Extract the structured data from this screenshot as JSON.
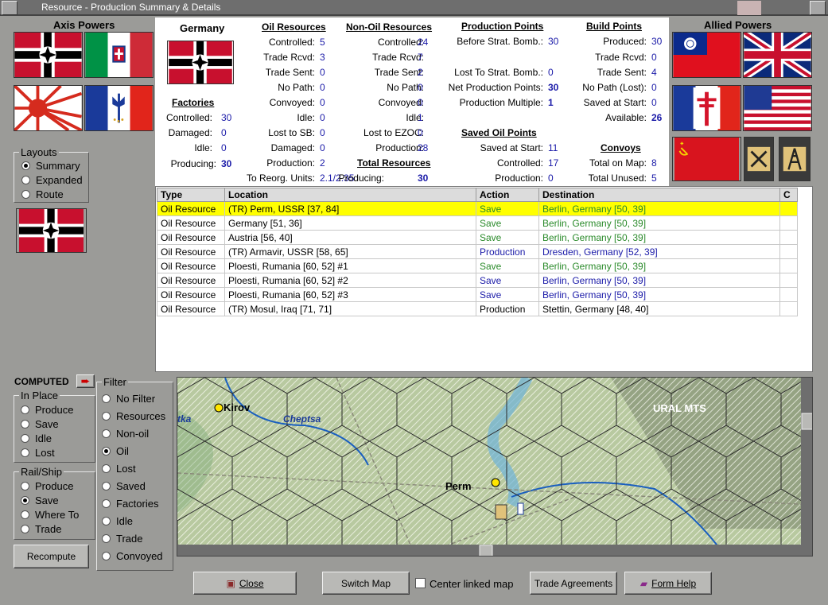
{
  "window": {
    "title": "Resource - Production Summary & Details"
  },
  "axis": {
    "title": "Axis Powers"
  },
  "allied": {
    "title": "Allied Powers"
  },
  "germany": {
    "name": "Germany"
  },
  "factories": {
    "title": "Factories",
    "rows": [
      {
        "label": "Controlled:",
        "value": "30"
      },
      {
        "label": "Damaged:",
        "value": "0"
      },
      {
        "label": "Idle:",
        "value": "0"
      },
      {
        "label": "Producing:",
        "value": "30"
      }
    ]
  },
  "oil": {
    "title": "Oil Resources",
    "rows": [
      {
        "label": "Controlled:",
        "value": "5"
      },
      {
        "label": "Trade Rcvd:",
        "value": "3"
      },
      {
        "label": "Trade Sent:",
        "value": "0"
      },
      {
        "label": "No Path:",
        "value": "0"
      },
      {
        "label": "Convoyed:",
        "value": "0"
      },
      {
        "label": "Idle:",
        "value": "0"
      },
      {
        "label": "Lost to SB:",
        "value": "0"
      },
      {
        "label": "Damaged:",
        "value": "0"
      },
      {
        "label": "Production:",
        "value": "2"
      },
      {
        "label": "To Reorg. Units:",
        "value": "2.1/2.35"
      }
    ]
  },
  "nonoil": {
    "title": "Non-Oil Resources",
    "rows": [
      {
        "label": "Controlled:",
        "value": "24"
      },
      {
        "label": "Trade Rcvd:",
        "value": "7"
      },
      {
        "label": "Trade Sent:",
        "value": "2"
      },
      {
        "label": "No Path:",
        "value": "0"
      },
      {
        "label": "Convoyed:",
        "value": "0"
      },
      {
        "label": "Idle:",
        "value": "1"
      },
      {
        "label": "Lost to EZOC:",
        "value": "0"
      },
      {
        "label": "Production:",
        "value": "28"
      }
    ]
  },
  "total": {
    "title": "Total Resources",
    "label": "Producing:",
    "value": "30"
  },
  "pp": {
    "title": "Production Points",
    "rows": [
      {
        "label": "Before Strat. Bomb.:",
        "value": "30"
      },
      {
        "label": "Lost To Strat. Bomb.:",
        "value": "0"
      },
      {
        "label": "Net Production Points:",
        "value": "30"
      },
      {
        "label": "Production Multiple:",
        "value": "1"
      }
    ]
  },
  "savedoil": {
    "title": "Saved Oil Points",
    "rows": [
      {
        "label": "Saved at Start:",
        "value": "11"
      },
      {
        "label": "Controlled:",
        "value": "17"
      },
      {
        "label": "Production:",
        "value": "0"
      }
    ]
  },
  "bp": {
    "title": "Build Points",
    "rows": [
      {
        "label": "Produced:",
        "value": "30"
      },
      {
        "label": "Trade Rcvd:",
        "value": "0"
      },
      {
        "label": "Trade Sent:",
        "value": "4"
      },
      {
        "label": "No Path (Lost):",
        "value": "0"
      },
      {
        "label": "Saved at Start:",
        "value": "0"
      },
      {
        "label": "Available:",
        "value": "26"
      }
    ]
  },
  "convoys": {
    "title": "Convoys",
    "rows": [
      {
        "label": "Total on Map:",
        "value": "8"
      },
      {
        "label": "Total Unused:",
        "value": "5"
      }
    ]
  },
  "layouts": {
    "title": "Layouts",
    "options": [
      "Summary",
      "Expanded",
      "Route"
    ]
  },
  "table": {
    "headers": [
      "Type",
      "Location",
      "Action",
      "Destination",
      "C"
    ],
    "rows": [
      {
        "type": "Oil Resource",
        "location": "(TR) Perm, USSR [37, 84]",
        "action": "Save",
        "destination": "Berlin, Germany [50, 39]"
      },
      {
        "type": "Oil Resource",
        "location": "Germany [51, 36]",
        "action": "Save",
        "destination": "Berlin, Germany [50, 39]"
      },
      {
        "type": "Oil Resource",
        "location": "Austria [56, 40]",
        "action": "Save",
        "destination": "Berlin, Germany [50, 39]"
      },
      {
        "type": "Oil Resource",
        "location": "(TR) Armavir, USSR [58, 65]",
        "action": "Production",
        "destination": "Dresden, Germany [52, 39]"
      },
      {
        "type": "Oil Resource",
        "location": "Ploesti, Rumania [60, 52] #1",
        "action": "Save",
        "destination": "Berlin, Germany [50, 39]"
      },
      {
        "type": "Oil Resource",
        "location": "Ploesti, Rumania [60, 52] #2",
        "action": "Save",
        "destination": "Berlin, Germany [50, 39]"
      },
      {
        "type": "Oil Resource",
        "location": "Ploesti, Rumania [60, 52] #3",
        "action": "Save",
        "destination": "Berlin, Germany [50, 39]"
      },
      {
        "type": "Oil Resource",
        "location": "(TR) Mosul, Iraq [71, 71]",
        "action": "Production",
        "destination": "Stettin, Germany [48, 40]"
      }
    ]
  },
  "computed": {
    "label": "COMPUTED"
  },
  "inplace": {
    "title": "In Place",
    "options": [
      "Produce",
      "Save",
      "Idle",
      "Lost"
    ]
  },
  "railship": {
    "title": "Rail/Ship",
    "options": [
      "Produce",
      "Save",
      "Where To",
      "Trade"
    ]
  },
  "filter": {
    "title": "Filter",
    "options": [
      "No Filter",
      "Resources",
      "Non-oil",
      "Oil",
      "Lost",
      "Saved",
      "Factories",
      "Idle",
      "Trade",
      "Convoyed"
    ]
  },
  "recompute": {
    "label": "Recompute"
  },
  "map": {
    "labels": {
      "kirov": "Kirov",
      "cheptsa": "Cheptsa",
      "ural": "URAL MTS",
      "perm": "Perm",
      "tka": "tka"
    }
  },
  "buttons": {
    "close": "Close",
    "switch_map": "Switch Map",
    "center_linked": "Center linked map",
    "trade": "Trade Agreements",
    "help": "Form Help"
  }
}
